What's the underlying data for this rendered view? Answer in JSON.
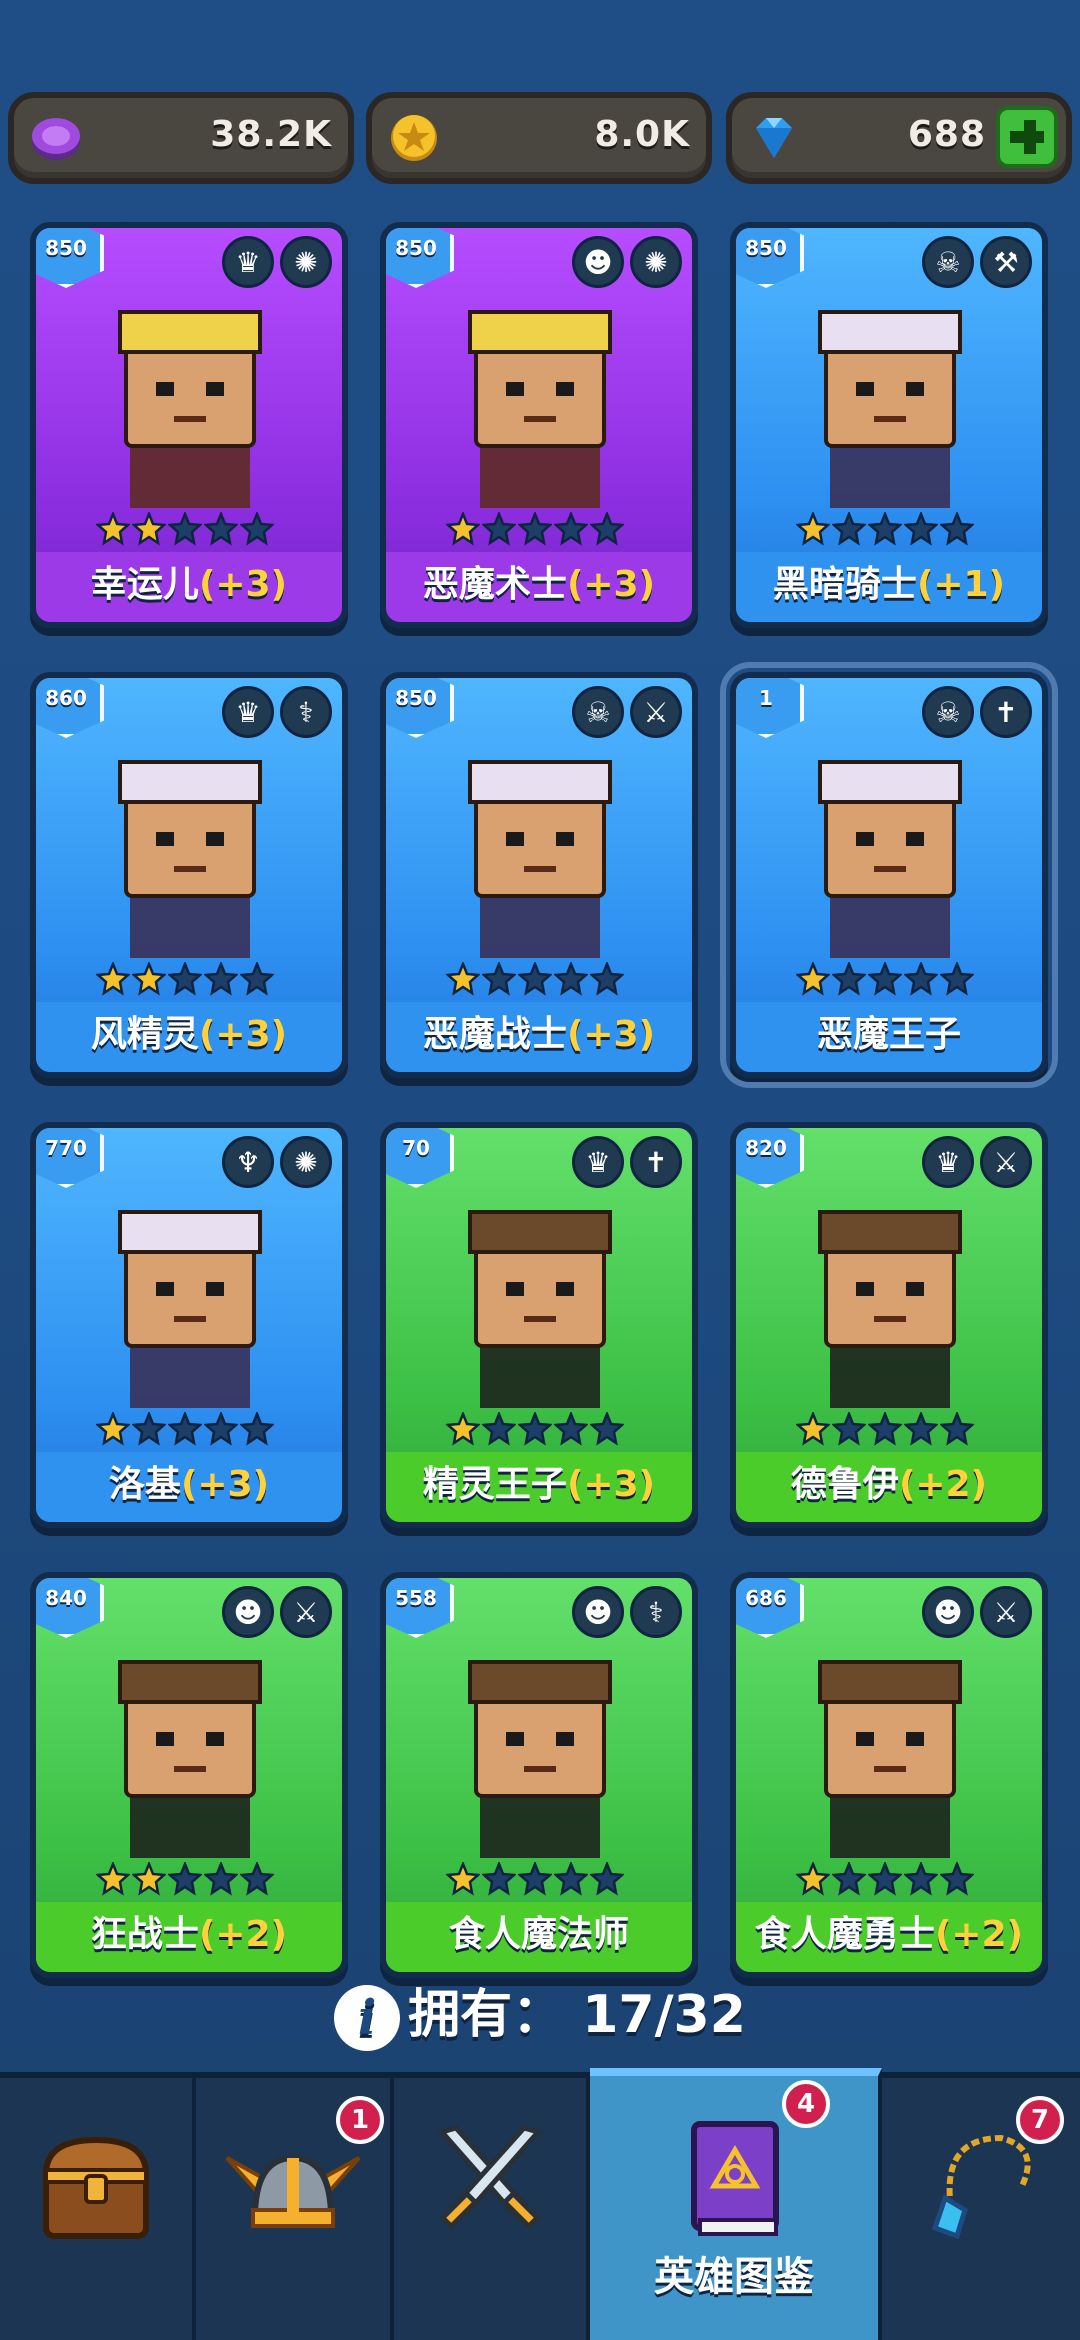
{
  "currency": [
    {
      "icon": "purple-gem-coin-icon",
      "value": "38.2K"
    },
    {
      "icon": "gold-coin-icon",
      "value": "8.0K"
    },
    {
      "icon": "diamond-icon",
      "value": "688"
    }
  ],
  "heroes": [
    {
      "name": "幸运儿",
      "bonus": "(+3)",
      "level": "850",
      "stars": 2,
      "color": "purple",
      "race_icon": "elf-race-icon",
      "weapon_icon": "magic-weapon-icon"
    },
    {
      "name": "恶魔术士",
      "bonus": "(+3)",
      "level": "850",
      "stars": 1,
      "color": "purple",
      "race_icon": "orc-race-icon",
      "weapon_icon": "magic-weapon-icon"
    },
    {
      "name": "黑暗骑士",
      "bonus": "(+1)",
      "level": "850",
      "stars": 1,
      "color": "blue",
      "race_icon": "demon-race-icon",
      "weapon_icon": "hammer-weapon-icon"
    },
    {
      "name": "风精灵",
      "bonus": "(+3)",
      "level": "860",
      "stars": 2,
      "color": "blue",
      "race_icon": "elf-race-icon",
      "weapon_icon": "staff-weapon-icon"
    },
    {
      "name": "恶魔战士",
      "bonus": "(+3)",
      "level": "850",
      "stars": 1,
      "color": "blue",
      "race_icon": "demon-race-icon",
      "weapon_icon": "sword-weapon-icon"
    },
    {
      "name": "恶魔王子",
      "bonus": "",
      "level": "1",
      "stars": 1,
      "color": "blue",
      "race_icon": "demon-race-icon",
      "weapon_icon": "dagger-weapon-icon",
      "selected": true
    },
    {
      "name": "洛基",
      "bonus": "(+3)",
      "level": "770",
      "stars": 1,
      "color": "blue",
      "race_icon": "angel-race-icon",
      "weapon_icon": "magic-weapon-icon"
    },
    {
      "name": "精灵王子",
      "bonus": "(+3)",
      "level": "70",
      "stars": 1,
      "color": "green",
      "race_icon": "elf-race-icon",
      "weapon_icon": "dagger-weapon-icon"
    },
    {
      "name": "德鲁伊",
      "bonus": "(+2)",
      "level": "820",
      "stars": 1,
      "color": "green",
      "race_icon": "elf-race-icon",
      "weapon_icon": "sword-weapon-icon"
    },
    {
      "name": "狂战士",
      "bonus": "(+2)",
      "level": "840",
      "stars": 2,
      "color": "green",
      "race_icon": "orc-race-icon",
      "weapon_icon": "sword-weapon-icon"
    },
    {
      "name": "食人魔法师",
      "bonus": "",
      "level": "558",
      "stars": 1,
      "color": "green",
      "race_icon": "orc-race-icon",
      "weapon_icon": "staff-weapon-icon"
    },
    {
      "name": "食人魔勇士",
      "bonus": "(+2)",
      "level": "686",
      "stars": 1,
      "color": "green",
      "race_icon": "orc-race-icon",
      "weapon_icon": "sword-weapon-icon"
    }
  ],
  "owned": {
    "label": "拥有：",
    "value": "17/32"
  },
  "nav": [
    {
      "icon": "treasure-chest-icon",
      "label": "",
      "badge": ""
    },
    {
      "icon": "winged-helmet-icon",
      "label": "",
      "badge": "1"
    },
    {
      "icon": "crossed-swords-icon",
      "label": "",
      "badge": ""
    },
    {
      "icon": "hero-book-icon",
      "label": "英雄图鉴",
      "badge": "4",
      "active": true
    },
    {
      "icon": "amulet-icon",
      "label": "",
      "badge": "7"
    }
  ],
  "colors": {
    "purple": "#9c3ae8",
    "blue": "#2f92ee",
    "green": "#4ccc2b",
    "bonus": "#ffd23c",
    "badge": "#d1204e"
  }
}
